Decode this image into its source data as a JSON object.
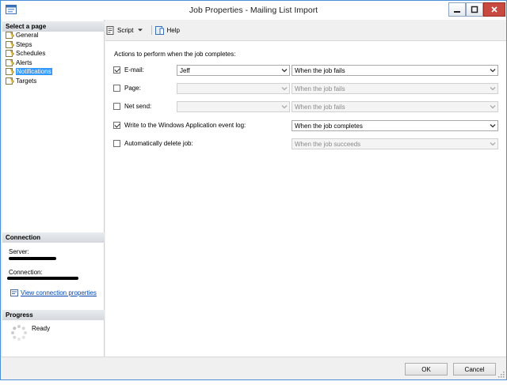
{
  "window": {
    "title": "Job Properties - Mailing List Import"
  },
  "left": {
    "select_page_header": "Select a page",
    "pages": [
      {
        "label": "General",
        "selected": false
      },
      {
        "label": "Steps",
        "selected": false
      },
      {
        "label": "Schedules",
        "selected": false
      },
      {
        "label": "Alerts",
        "selected": false
      },
      {
        "label": "Notifications",
        "selected": true
      },
      {
        "label": "Targets",
        "selected": false
      }
    ],
    "connection_header": "Connection",
    "server_label": "Server:",
    "connection_label": "Connection:",
    "view_conn_props": "View connection properties",
    "progress_header": "Progress",
    "progress_status": "Ready"
  },
  "toolbar": {
    "script_label": "Script",
    "help_label": "Help"
  },
  "main": {
    "section_label": "Actions to perform when the job completes:",
    "rows": [
      {
        "label": "E-mail:",
        "checked": true,
        "operator_value": "Jeff",
        "operator_enabled": true,
        "when_value": "When the job fails",
        "when_enabled": true
      },
      {
        "label": "Page:",
        "checked": false,
        "operator_value": "",
        "operator_enabled": false,
        "when_value": "When the job fails",
        "when_enabled": false
      },
      {
        "label": "Net send:",
        "checked": false,
        "operator_value": "",
        "operator_enabled": false,
        "when_value": "When the job fails",
        "when_enabled": false
      },
      {
        "label": "Write to the Windows Application event log:",
        "checked": true,
        "when_value": "When the job completes",
        "when_enabled": true
      },
      {
        "label": "Automatically delete job:",
        "checked": false,
        "when_value": "When the job succeeds",
        "when_enabled": false
      }
    ]
  },
  "footer": {
    "ok_label": "OK",
    "cancel_label": "Cancel"
  },
  "colors": {
    "accent": "#3399ff",
    "link": "#0645ad",
    "close": "#c7493f"
  }
}
